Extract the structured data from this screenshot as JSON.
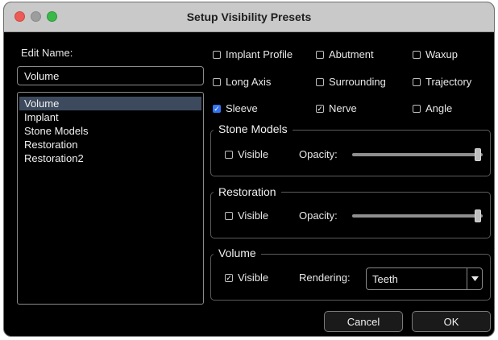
{
  "window": {
    "title": "Setup Visibility Presets",
    "controls": [
      "close-button",
      "minimize-button",
      "zoom-button"
    ]
  },
  "edit_name": {
    "label": "Edit Name:",
    "value": "Volume"
  },
  "presets": {
    "selected": "Volume",
    "items": [
      "Volume",
      "Implant",
      "Stone Models",
      "Restoration",
      "Restoration2"
    ]
  },
  "checkboxes": {
    "implant_profile": {
      "label": "Implant Profile",
      "checked": false
    },
    "abutment": {
      "label": "Abutment",
      "checked": false
    },
    "waxup": {
      "label": "Waxup",
      "checked": false
    },
    "long_axis": {
      "label": "Long Axis",
      "checked": false
    },
    "surrounding": {
      "label": "Surrounding",
      "checked": false
    },
    "trajectory": {
      "label": "Trajectory",
      "checked": false
    },
    "sleeve": {
      "label": "Sleeve",
      "checked": true
    },
    "nerve": {
      "label": "Nerve",
      "checked": true
    },
    "angle": {
      "label": "Angle",
      "checked": false
    }
  },
  "stone_models": {
    "title": "Stone Models",
    "visible_label": "Visible",
    "visible": false,
    "opacity_label": "Opacity:",
    "opacity": 1.0
  },
  "restoration": {
    "title": "Restoration",
    "visible_label": "Visible",
    "visible": false,
    "opacity_label": "Opacity:",
    "opacity": 1.0
  },
  "volume": {
    "title": "Volume",
    "visible_label": "Visible",
    "visible": true,
    "rendering_label": "Rendering:",
    "rendering_value": "Teeth"
  },
  "buttons": {
    "cancel": "Cancel",
    "ok": "OK"
  },
  "colors": {
    "window_bg": "#000000",
    "titlebar": "#c9c9c9",
    "selection": "#3d4a5e",
    "check_accent": "#3574f0"
  }
}
